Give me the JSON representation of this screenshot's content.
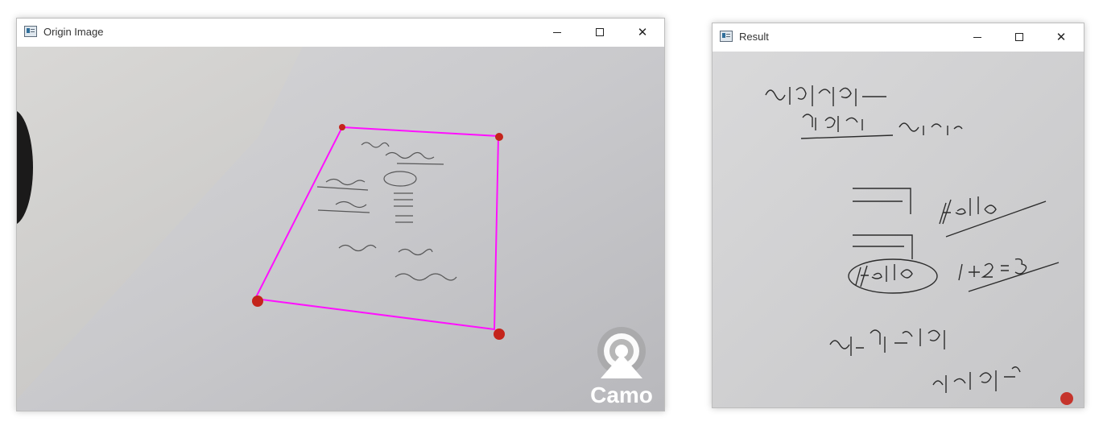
{
  "origin_window": {
    "title": "Origin Image",
    "icons": {
      "app": "window-app-icon",
      "minimize": "minimize-icon",
      "maximize": "maximize-icon",
      "close": "close-icon"
    },
    "overlay_label": "Camo",
    "colors": {
      "outline": "#ff10ff",
      "corner_marker": "#c4241b"
    }
  },
  "result_window": {
    "title": "Result",
    "icons": {
      "app": "window-app-icon",
      "minimize": "minimize-icon",
      "maximize": "maximize-icon",
      "close": "close-icon"
    }
  }
}
